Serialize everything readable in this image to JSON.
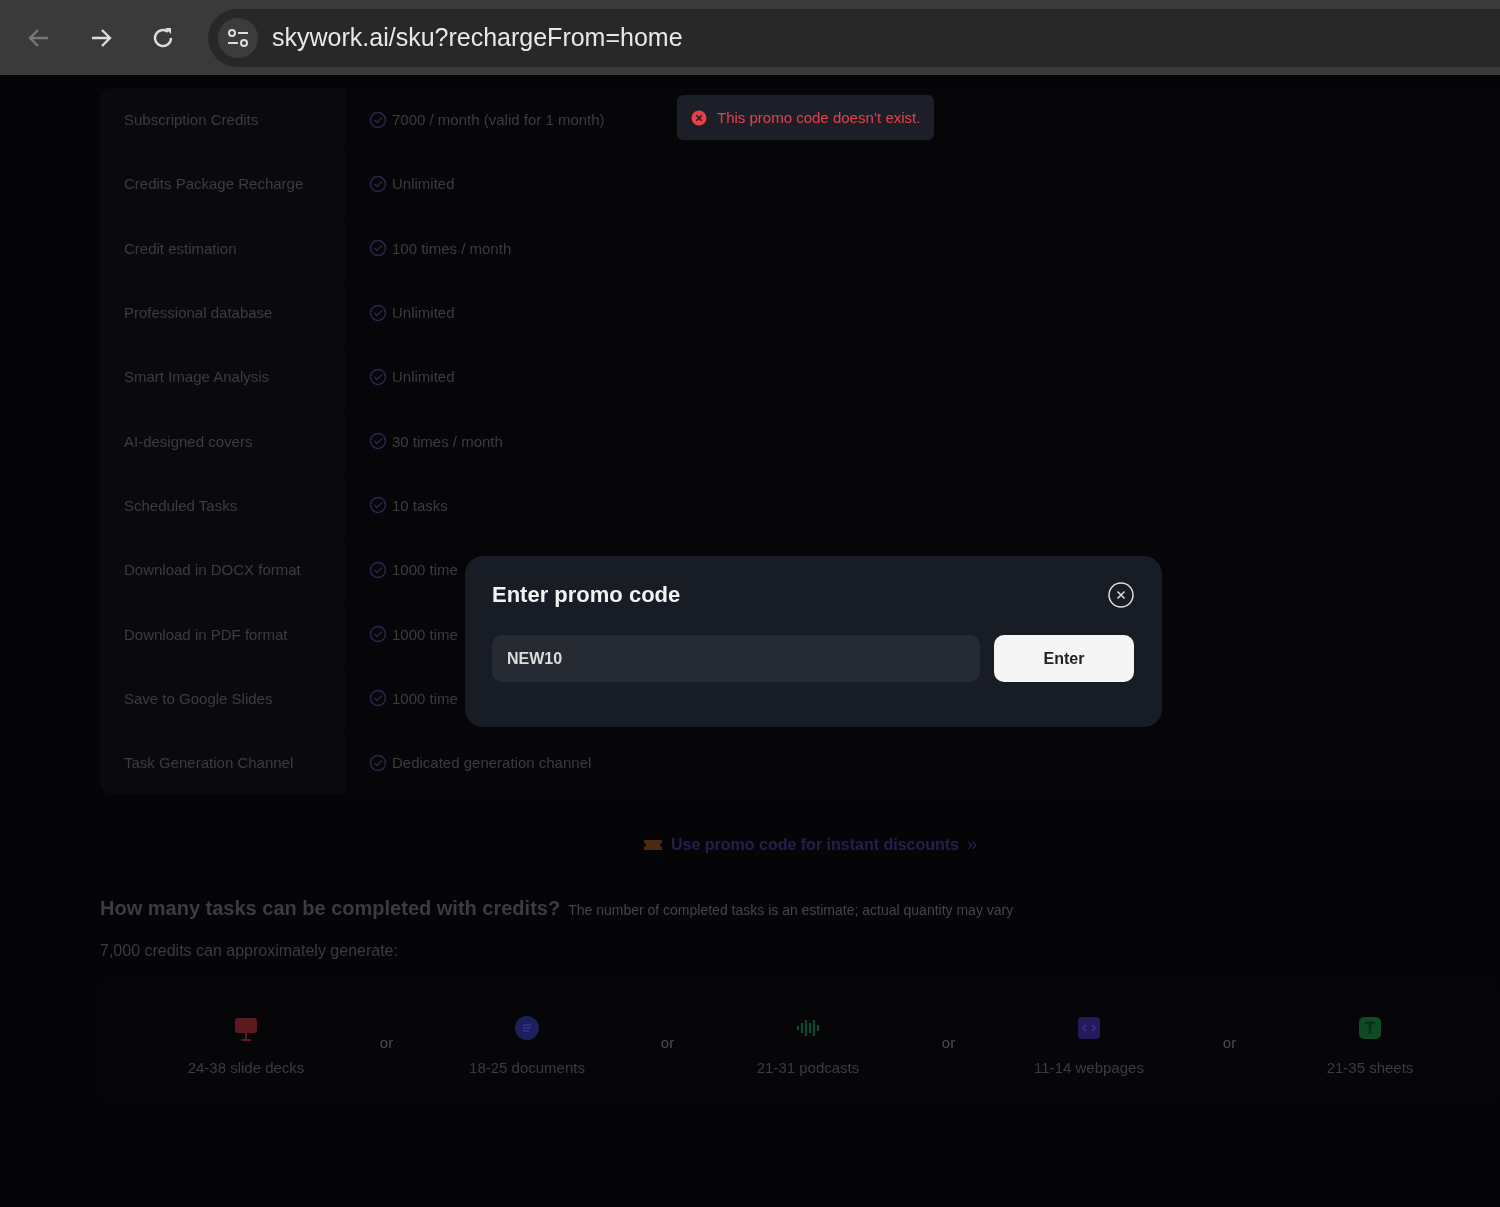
{
  "browser": {
    "url": "skywork.ai/sku?rechargeFrom=home"
  },
  "features": [
    {
      "label": "Subscription Credits",
      "value": "7000 / month (valid for 1 month)"
    },
    {
      "label": "Credits Package Recharge",
      "value": "Unlimited"
    },
    {
      "label": "Credit estimation",
      "value": "100 times / month"
    },
    {
      "label": "Professional database",
      "value": "Unlimited"
    },
    {
      "label": "Smart Image Analysis",
      "value": "Unlimited"
    },
    {
      "label": "AI-designed covers",
      "value": "30 times / month"
    },
    {
      "label": "Scheduled Tasks",
      "value": "10 tasks"
    },
    {
      "label": "Download in DOCX format",
      "value": "1000 time"
    },
    {
      "label": "Download in PDF format",
      "value": "1000 time"
    },
    {
      "label": "Save to Google Slides",
      "value": "1000 time"
    },
    {
      "label": "Task Generation Channel",
      "value": "Dedicated generation channel"
    }
  ],
  "toast": {
    "message": "This promo code doesn’t exist."
  },
  "promo_link": {
    "label": "Use promo code for instant discounts",
    "arrow": "»"
  },
  "credits": {
    "title": "How many tasks can be completed with credits?",
    "note": "The number of completed tasks is an estimate; actual quantity may vary",
    "subtitle": "7,000 credits can approximately generate:",
    "items": [
      {
        "label": "24-38 slide decks",
        "separator": "or"
      },
      {
        "label": "18-25 documents",
        "separator": "or"
      },
      {
        "label": "21-31 podcasts",
        "separator": "or"
      },
      {
        "label": "11-14 webpages",
        "separator": "or"
      },
      {
        "label": "21-35 sheets"
      }
    ]
  },
  "modal": {
    "title": "Enter promo code",
    "value": "NEW10",
    "button": "Enter"
  }
}
